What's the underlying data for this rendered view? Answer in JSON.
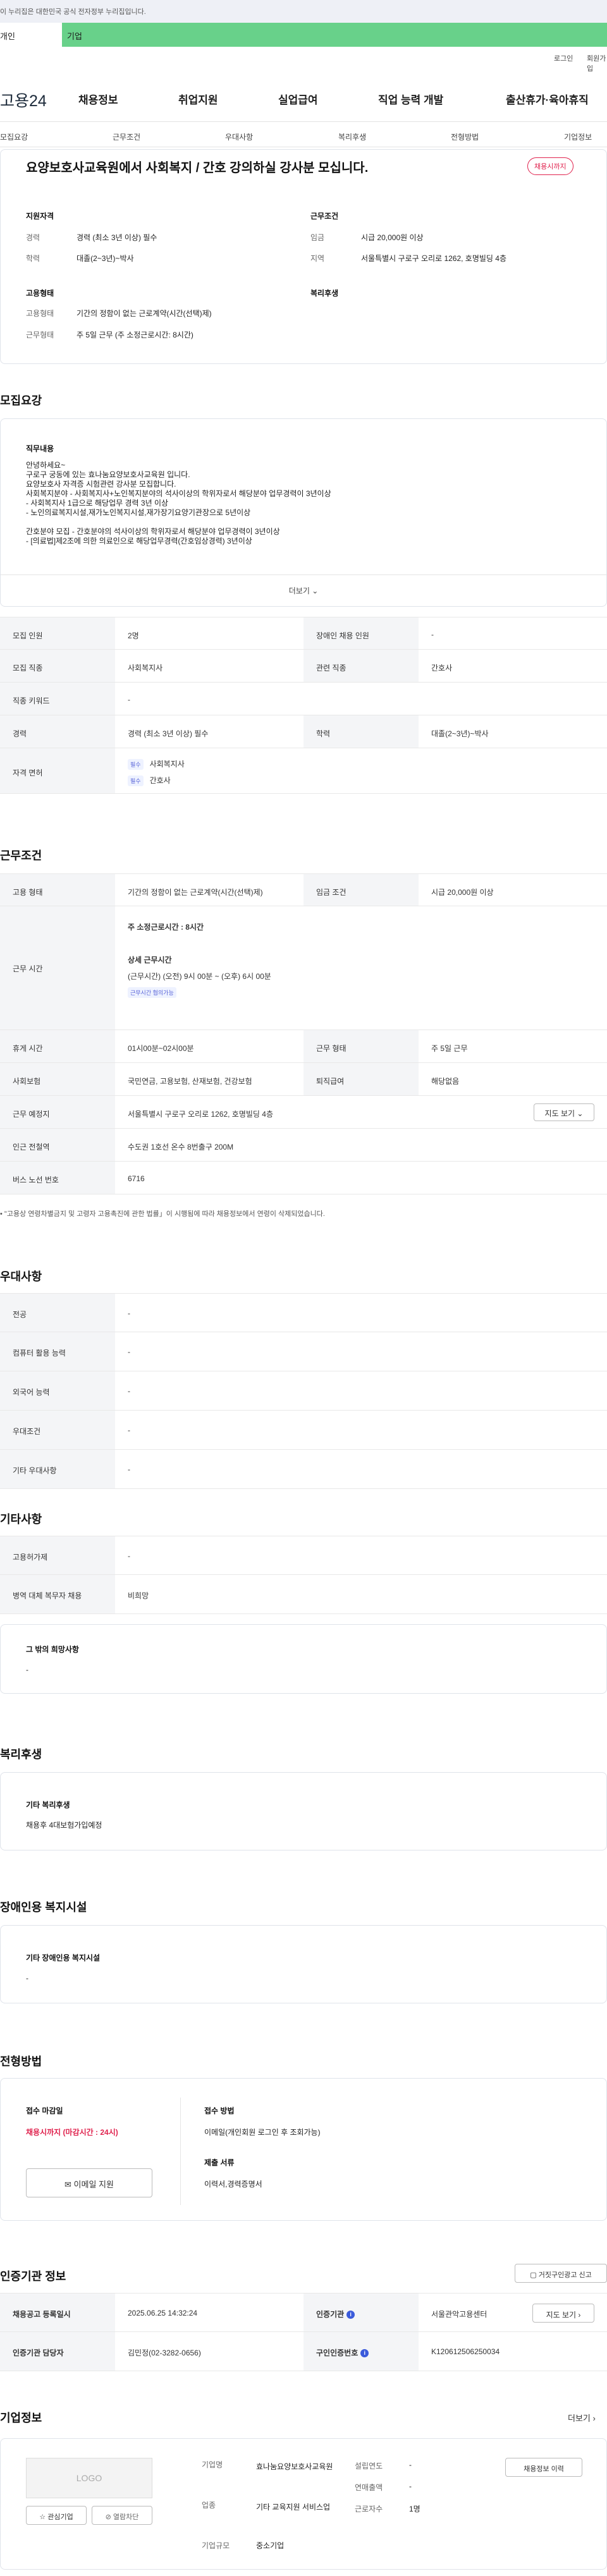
{
  "gov_notice": "이 누리집은 대한민국 공식 전자정부 누리집입니다.",
  "top_tabs": [
    "개인",
    "기업"
  ],
  "util": {
    "login": "로그인",
    "join": "회원가입"
  },
  "logo": "고용24",
  "gnb": [
    "채용정보",
    "취업지원",
    "실업급여",
    "직업 능력 개발",
    "출산휴가·육아휴직"
  ],
  "subnav": [
    "모집요강",
    "근무조건",
    "우대사항",
    "복리후생",
    "전형방법",
    "기업정보"
  ],
  "job": {
    "title": "요양보호사교육원에서 사회복지 / 간호 강의하실 강사분 모십니다.",
    "status_badge": "채용시까지",
    "summary": {
      "qual_title": "지원자격",
      "career_lbl": "경력",
      "career": "경력 (최소 3년 이상) 필수",
      "edu_lbl": "학력",
      "edu": "대졸(2~3년)~박사",
      "cond_title": "근무조건",
      "wage_lbl": "임금",
      "wage": "시급 20,000원 이상",
      "loc_lbl": "지역",
      "loc": "서울특별시 구로구 오리로 1262, 호명빌딩 4층",
      "emp_title": "고용형태",
      "emp_type_lbl": "고용형태",
      "emp_type": "기간의 정함이 없는 근로계약(시간(선택)제)",
      "work_type_lbl": "근무형태",
      "work_type": "주 5일 근무 (주 소정근로시간: 8시간)",
      "welfare_title": "복리후생"
    }
  },
  "recruit": {
    "heading": "모집요강",
    "duty_title": "직무내용",
    "duty_text": "안녕하세요~\n구로구 궁동에 있는 효나눔요양보호사교육원 입니다.\n요양보호사 자격증 시험관련 강사분 모집합니다.\n사회복지분야 - 사회복지사+노인복지분야의 석사이상의 학위자로서 해당분야 업무경력이 3년이상\n                          - 사회복지사 1급으로 해당업무 경력 3년 이상\n                          - 노인의료복지시설,재가노인복지시설,재가장기요양기관장으로 5년이상\n\n간호분야 모집 - 간호분야의 석사이상의 학위자로서 해당분야 업무경력이 3년이상\n                          - [의료법]제2조에 의한 의료인으로 해당업무경력(간호임상경력) 3년이상",
    "more": "더보기",
    "rows": [
      {
        "l1": "모집 인원",
        "v1": "2명",
        "l2": "장애인 채용 인원",
        "v2": "-"
      },
      {
        "l1": "모집 직종",
        "v1": "사회복지사",
        "l2": "관련 직종",
        "v2": "간호사"
      },
      {
        "l1": "직종 키워드",
        "v1": "-"
      },
      {
        "l1": "경력",
        "v1": "경력 (최소 3년 이상) 필수",
        "l2": "학력",
        "v2": "대졸(2~3년)~박사"
      }
    ],
    "license_lbl": "자격 면허",
    "licenses": [
      {
        "badge": "필수",
        "name": "사회복지사"
      },
      {
        "badge": "필수",
        "name": "간호사"
      }
    ]
  },
  "conditions": {
    "heading": "근무조건",
    "emp_lbl": "고용 형태",
    "emp": "기간의 정함이 없는 근로계약(시간(선택)제)",
    "wage_lbl": "임금 조건",
    "wage": "시급 20,000원 이상",
    "time_lbl": "근무 시간",
    "time_main": "주 소정근로시간 : 8시간",
    "time_detail_t": "상세 근무시간",
    "time_detail": "(근무시간) (오전) 9시 00분 ~ (오후) 6시 00분",
    "time_badge": "근무시간 협의가능",
    "rest_lbl": "휴게 시간",
    "rest": "01시00분~02시00분",
    "form_lbl": "근무 형태",
    "form": "주 5일 근무",
    "ins_lbl": "사회보험",
    "ins": "국민연금, 고용보험, 산재보험, 건강보험",
    "sev_lbl": "퇴직급여",
    "sev": "해당없음",
    "place_lbl": "근무 예정지",
    "place": "서울특별시 구로구 오리로 1262, 호명빌딩 4층",
    "map_btn": "지도 보기",
    "sub_lbl": "인근 전철역",
    "sub": "수도권 1호선 온수 8번출구 200M",
    "bus_lbl": "버스 노선 번호",
    "bus": "6716",
    "note": "\"고용상 연령차별금지 및 고령자 고용촉진에 관한 법률」이 시행됨에 따라 채용정보에서 연령이 삭제되었습니다."
  },
  "pref": {
    "heading": "우대사항",
    "rows": [
      {
        "l": "전공",
        "v": "-"
      },
      {
        "l": "컴퓨터 활용 능력",
        "v": "-"
      },
      {
        "l": "외국어 능력",
        "v": "-"
      },
      {
        "l": "우대조건",
        "v": "-"
      },
      {
        "l": "기타 우대사항",
        "v": "-"
      }
    ]
  },
  "etc": {
    "heading": "기타사항",
    "rows": [
      {
        "l": "고용허가제",
        "v": "-"
      },
      {
        "l": "병역 대체 복무자 채용",
        "v": "비희망"
      }
    ],
    "hope_title": "그 밖의 희망사항",
    "hope": "-"
  },
  "welfare": {
    "heading": "복리후생",
    "title": "기타 복리후생",
    "text": "채용후 4대보험가입예정"
  },
  "disab": {
    "heading": "장애인용 복지시설",
    "title": "기타 장애인용 복지시설",
    "text": "-"
  },
  "process": {
    "heading": "전형방법",
    "deadline_t": "접수 마감일",
    "deadline": "채용시까지 (마감시간 : 24시)",
    "apply_btn": "이메일 지원",
    "method_t": "접수 방법",
    "method": "이메일(개인회원 로그인 후 조회가능)",
    "docs_t": "제출 서류",
    "docs": "이력서,경력증명서"
  },
  "cert": {
    "heading": "인증기관 정보",
    "report_btn": "거짓구인광고 신고",
    "reg_lbl": "채용공고 등록일시",
    "reg": "2025.06.25 14:32:24",
    "agency_lbl": "인증기관",
    "agency": "서울관악고용센터",
    "agency_btn": "지도 보기",
    "mgr_lbl": "인증기관 담당자",
    "mgr": "김민정(02-3282-0656)",
    "no_lbl": "구인인증번호",
    "no": "K120612506250034"
  },
  "company": {
    "heading": "기업정보",
    "more": "더보기",
    "logo": "LOGO",
    "fav_btn": "관심기업",
    "block_btn": "열람차단",
    "name_lbl": "기업명",
    "name": "효나눔요양보호사교육원",
    "ind_lbl": "업종",
    "ind": "기타 교육지원 서비스업",
    "size_lbl": "기업규모",
    "size": "중소기업",
    "est_lbl": "설립연도",
    "est": "-",
    "sales_lbl": "연매출액",
    "sales": "-",
    "emp_lbl": "근로자수",
    "emp": "1명",
    "info_btn": "채용정보 이력"
  }
}
